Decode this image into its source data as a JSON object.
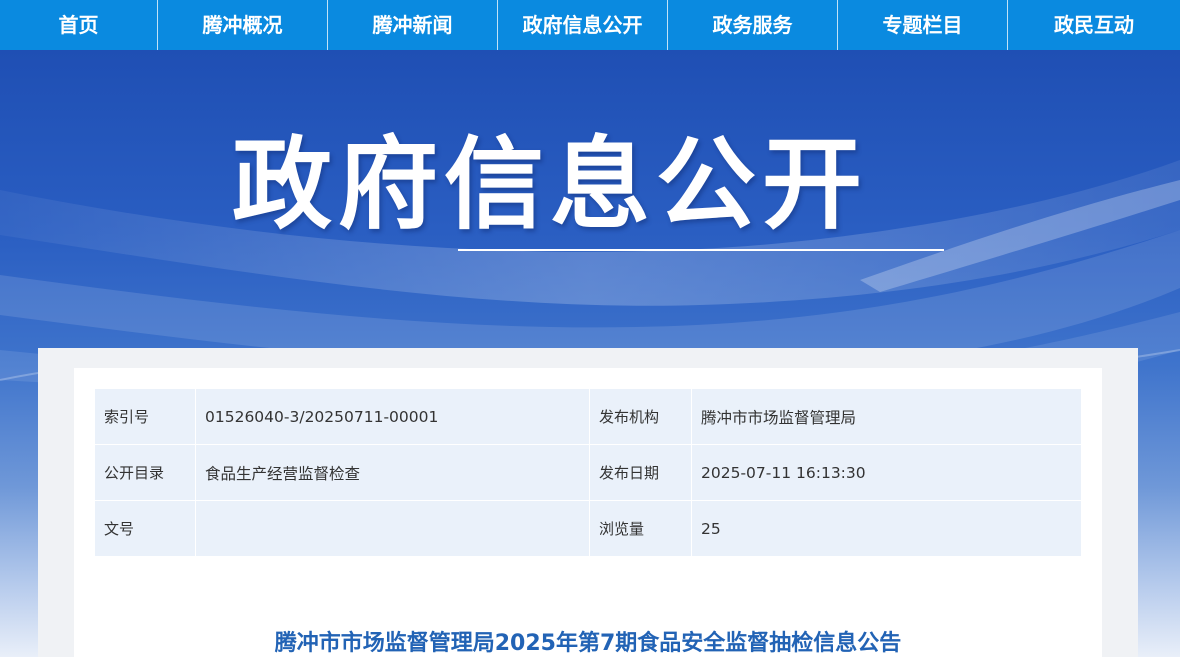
{
  "nav": {
    "items": [
      {
        "label": "首页"
      },
      {
        "label": "腾冲概况"
      },
      {
        "label": "腾冲新闻"
      },
      {
        "label": "政府信息公开"
      },
      {
        "label": "政务服务"
      },
      {
        "label": "专题栏目"
      },
      {
        "label": "政民互动"
      }
    ]
  },
  "banner": {
    "title": "政府信息公开"
  },
  "info_table": {
    "rows": [
      {
        "label1": "索引号",
        "value1": "01526040-3/20250711-00001",
        "label2": "发布机构",
        "value2": "腾冲市市场监督管理局"
      },
      {
        "label1": "公开目录",
        "value1": "食品生产经营监督检查",
        "label2": "发布日期",
        "value2": "2025-07-11 16:13:30"
      },
      {
        "label1": "文号",
        "value1": "",
        "label2": "浏览量",
        "value2": "25"
      }
    ]
  },
  "article": {
    "title": "腾冲市市场监督管理局2025年第7期食品安全监督抽检信息公告"
  },
  "colors": {
    "nav_bg": "#0a8ae0",
    "banner_blue": "#2a5ec2",
    "table_bg": "#eaf1fa",
    "title_blue": "#2263b5"
  }
}
